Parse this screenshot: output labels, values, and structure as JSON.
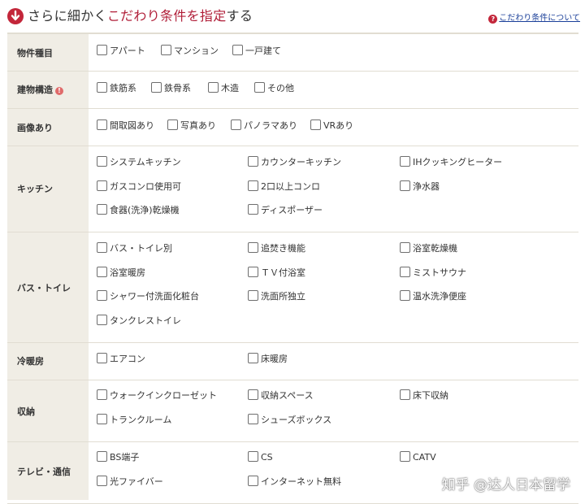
{
  "header": {
    "title_pre": "さらに細かく",
    "title_hl": "こだわり条件を指定",
    "title_post": "する",
    "help_link": "こだわり条件について"
  },
  "rows": [
    {
      "label": "物件種目",
      "options": [
        "アパート",
        "マンション",
        "一戸建て"
      ]
    },
    {
      "label": "建物構造",
      "options": [
        "鉄筋系",
        "鉄骨系",
        "木造",
        "その他"
      ]
    },
    {
      "label": "画像あり",
      "options": [
        "間取図あり",
        "写真あり",
        "パノラマあり",
        "VRあり"
      ]
    },
    {
      "label": "キッチン",
      "options": [
        "システムキッチン",
        "カウンターキッチン",
        "IHクッキングヒーター",
        "ガスコンロ使用可",
        "2口以上コンロ",
        "浄水器",
        "食器(洗浄)乾燥機",
        "ディスポーザー"
      ]
    },
    {
      "label": "バス・トイレ",
      "options": [
        "バス・トイレ別",
        "追焚き機能",
        "浴室乾燥機",
        "浴室暖房",
        "ＴＶ付浴室",
        "ミストサウナ",
        "シャワー付洗面化粧台",
        "洗面所独立",
        "温水洗浄便座",
        "タンクレストイレ"
      ]
    },
    {
      "label": "冷暖房",
      "options": [
        "エアコン",
        "床暖房"
      ]
    },
    {
      "label": "収納",
      "options": [
        "ウォークインクローゼット",
        "収納スペース",
        "床下収納",
        "トランクルーム",
        "シューズボックス"
      ]
    },
    {
      "label": "テレビ・通信",
      "options": [
        "BS端子",
        "CS",
        "CATV",
        "光ファイバー",
        "インターネット無料"
      ]
    }
  ],
  "watermark": "知乎 @达人日本留学",
  "colors": {
    "accent": "#c3263a",
    "label_bg": "#f0ede5",
    "link": "#1a3f99"
  }
}
